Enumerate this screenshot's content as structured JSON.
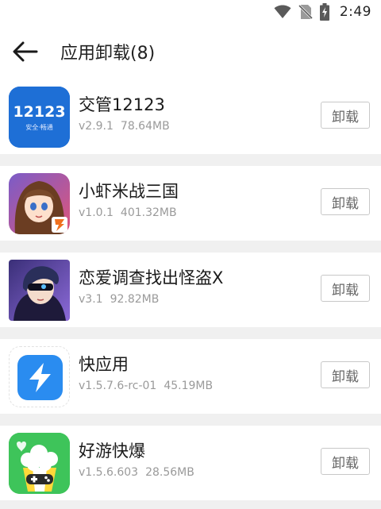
{
  "status_bar": {
    "time": "2:49",
    "icons": [
      "wifi-icon",
      "no-sim-icon",
      "battery-charging-icon"
    ]
  },
  "header": {
    "back_icon": "arrow-left-icon",
    "title": "应用卸载(8)"
  },
  "apps": [
    {
      "name": "交管12123",
      "version": "v2.9.1",
      "size": "78.64MB",
      "button": "卸载",
      "icon": "jiaoguan-12123-icon",
      "icon_text": "12123",
      "icon_subtext": "安全·畅通"
    },
    {
      "name": "小虾米战三国",
      "version": "v1.0.1",
      "size": "401.32MB",
      "button": "卸载",
      "icon": "anime-girl-game-icon"
    },
    {
      "name": "恋爱调查找出怪盗X",
      "version": "v3.1",
      "size": "92.82MB",
      "button": "卸载",
      "icon": "anime-boy-game-icon"
    },
    {
      "name": "快应用",
      "version": "v1.5.7.6-rc-01",
      "size": "45.19MB",
      "button": "卸载",
      "icon": "lightning-icon"
    },
    {
      "name": "好游快爆",
      "version": "v1.5.6.603",
      "size": "28.56MB",
      "button": "卸载",
      "icon": "popcorn-gamepad-icon"
    }
  ],
  "colors": {
    "jiaoguan_blue": "#1e6fd6",
    "quickapp_blue": "#2a8cf0",
    "haoyou_green": "#3ec45a",
    "divider": "#f0f0f0"
  }
}
